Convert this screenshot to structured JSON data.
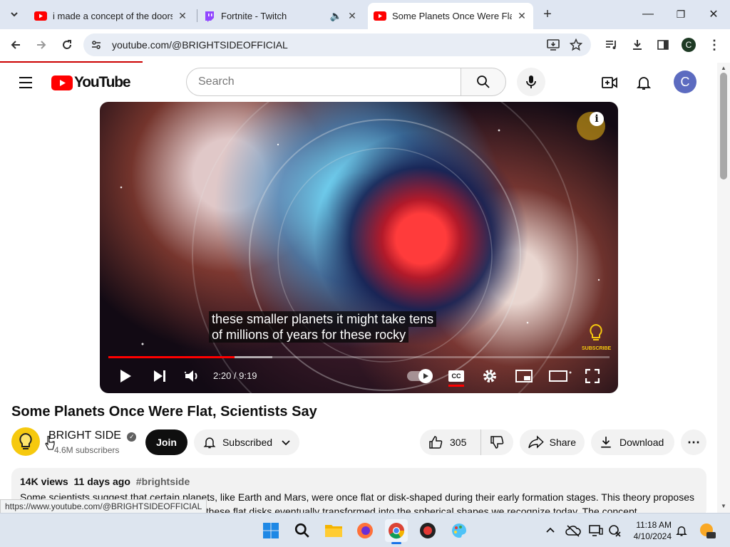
{
  "browser": {
    "tabs": [
      {
        "title": "i made a concept of the doors",
        "icon": "youtube-favicon"
      },
      {
        "title": "Fortnite - Twitch",
        "icon": "twitch-favicon",
        "audio": true
      },
      {
        "title": "Some Planets Once Were Flat,",
        "icon": "youtube-favicon",
        "active": true
      }
    ],
    "url": "youtube.com/@BRIGHTSIDEOFFICIAL",
    "status_url": "https://www.youtube.com/@BRIGHTSIDEOFFICIAL",
    "profile_initial": "C"
  },
  "youtube": {
    "logo_text": "YouTube",
    "search_placeholder": "Search",
    "avatar_initial": "C"
  },
  "player": {
    "caption_line1": "these smaller planets it might take tens",
    "caption_line2": "of millions of years for these rocky",
    "time": "2:20 / 9:19",
    "progress_played": 0.252,
    "progress_buffered": 0.327,
    "watermark_text": "SUBSCRIBE"
  },
  "video": {
    "title": "Some Planets Once Were Flat, Scientists Say",
    "channel_name": "BRIGHT SIDE",
    "subscribers": "4.6M subscribers",
    "join_label": "Join",
    "subscribed_label": "Subscribed",
    "likes": "305",
    "share_label": "Share",
    "download_label": "Download",
    "views": "14K views",
    "age": "11 days ago",
    "hashtag": "#brightside",
    "description_line1": "Some scientists suggest that certain planets, like Earth and Mars, were once flat or disk-shaped during their early formation stages. This theory proposes",
    "description_line2": "that through gravitational and tidal forces, these flat disks eventually transformed into the spherical shapes we recognize today. The concept"
  },
  "taskbar": {
    "time": "11:18 AM",
    "date": "4/10/2024"
  },
  "colors": {
    "youtube_red": "#ff0000",
    "tab_strip": "#dfe6f2",
    "avatar": "#5c6bc0"
  }
}
